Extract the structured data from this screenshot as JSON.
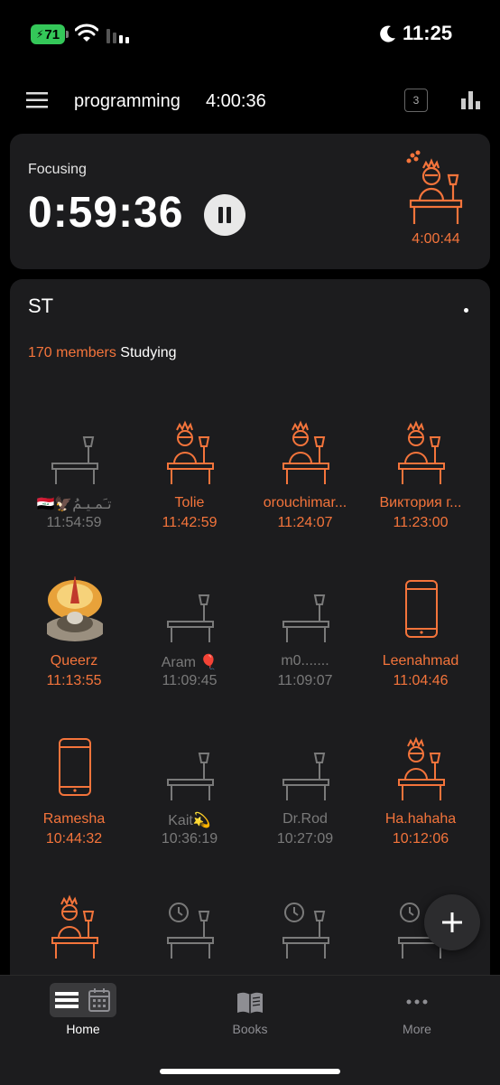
{
  "status_bar": {
    "battery": "71",
    "time": "11:25",
    "icons": [
      "battery-charging-icon",
      "wifi-icon",
      "cellular-signal-icon",
      "moon-icon"
    ]
  },
  "header": {
    "subject": "programming",
    "total_time": "4:00:36",
    "count": "3",
    "icons": [
      "menu-icon",
      "bar-chart-icon"
    ]
  },
  "focus": {
    "label": "Focusing",
    "timer": "0:59:36",
    "avatar_time": "4:00:44"
  },
  "group": {
    "name": "ST",
    "members_count": "170 members",
    "members_suffix": " Studying",
    "members": [
      {
        "name": "🇮🇶🦅تـَمـيـمُ",
        "time": "11:54:59",
        "state": "idle"
      },
      {
        "name": "Tolie",
        "time": "11:42:59",
        "state": "studying"
      },
      {
        "name": "orouchimar...",
        "time": "11:24:07",
        "state": "studying"
      },
      {
        "name": "Виктория г...",
        "time": "11:23:00",
        "state": "studying"
      },
      {
        "name": "Queerz",
        "time": "11:13:55",
        "state": "custom-avatar"
      },
      {
        "name": "Aram 🎈",
        "time": "11:09:45",
        "state": "idle"
      },
      {
        "name": "m0.......",
        "time": "11:09:07",
        "state": "idle"
      },
      {
        "name": "Leenahmad",
        "time": "11:04:46",
        "state": "phone"
      },
      {
        "name": "Ramesha",
        "time": "10:44:32",
        "state": "phone"
      },
      {
        "name": "Kait💫",
        "time": "10:36:19",
        "state": "idle"
      },
      {
        "name": "Dr.Rod",
        "time": "10:27:09",
        "state": "idle"
      },
      {
        "name": "Ha.hahaha",
        "time": "10:12:06",
        "state": "studying"
      },
      {
        "name": "",
        "time": "",
        "state": "studying"
      },
      {
        "name": "",
        "time": "",
        "state": "idle-clock"
      },
      {
        "name": "",
        "time": "",
        "state": "idle-clock"
      },
      {
        "name": "",
        "time": "",
        "state": "idle-clock"
      }
    ]
  },
  "tabs": [
    {
      "label": "Home",
      "icon": "home-list-icon",
      "active": true
    },
    {
      "label": "Books",
      "icon": "book-icon",
      "active": false
    },
    {
      "label": "More",
      "icon": "more-dots-icon",
      "active": false
    }
  ],
  "colors": {
    "accent": "#f4743b",
    "idle": "#7a7a7a",
    "card": "#1c1c1e"
  }
}
